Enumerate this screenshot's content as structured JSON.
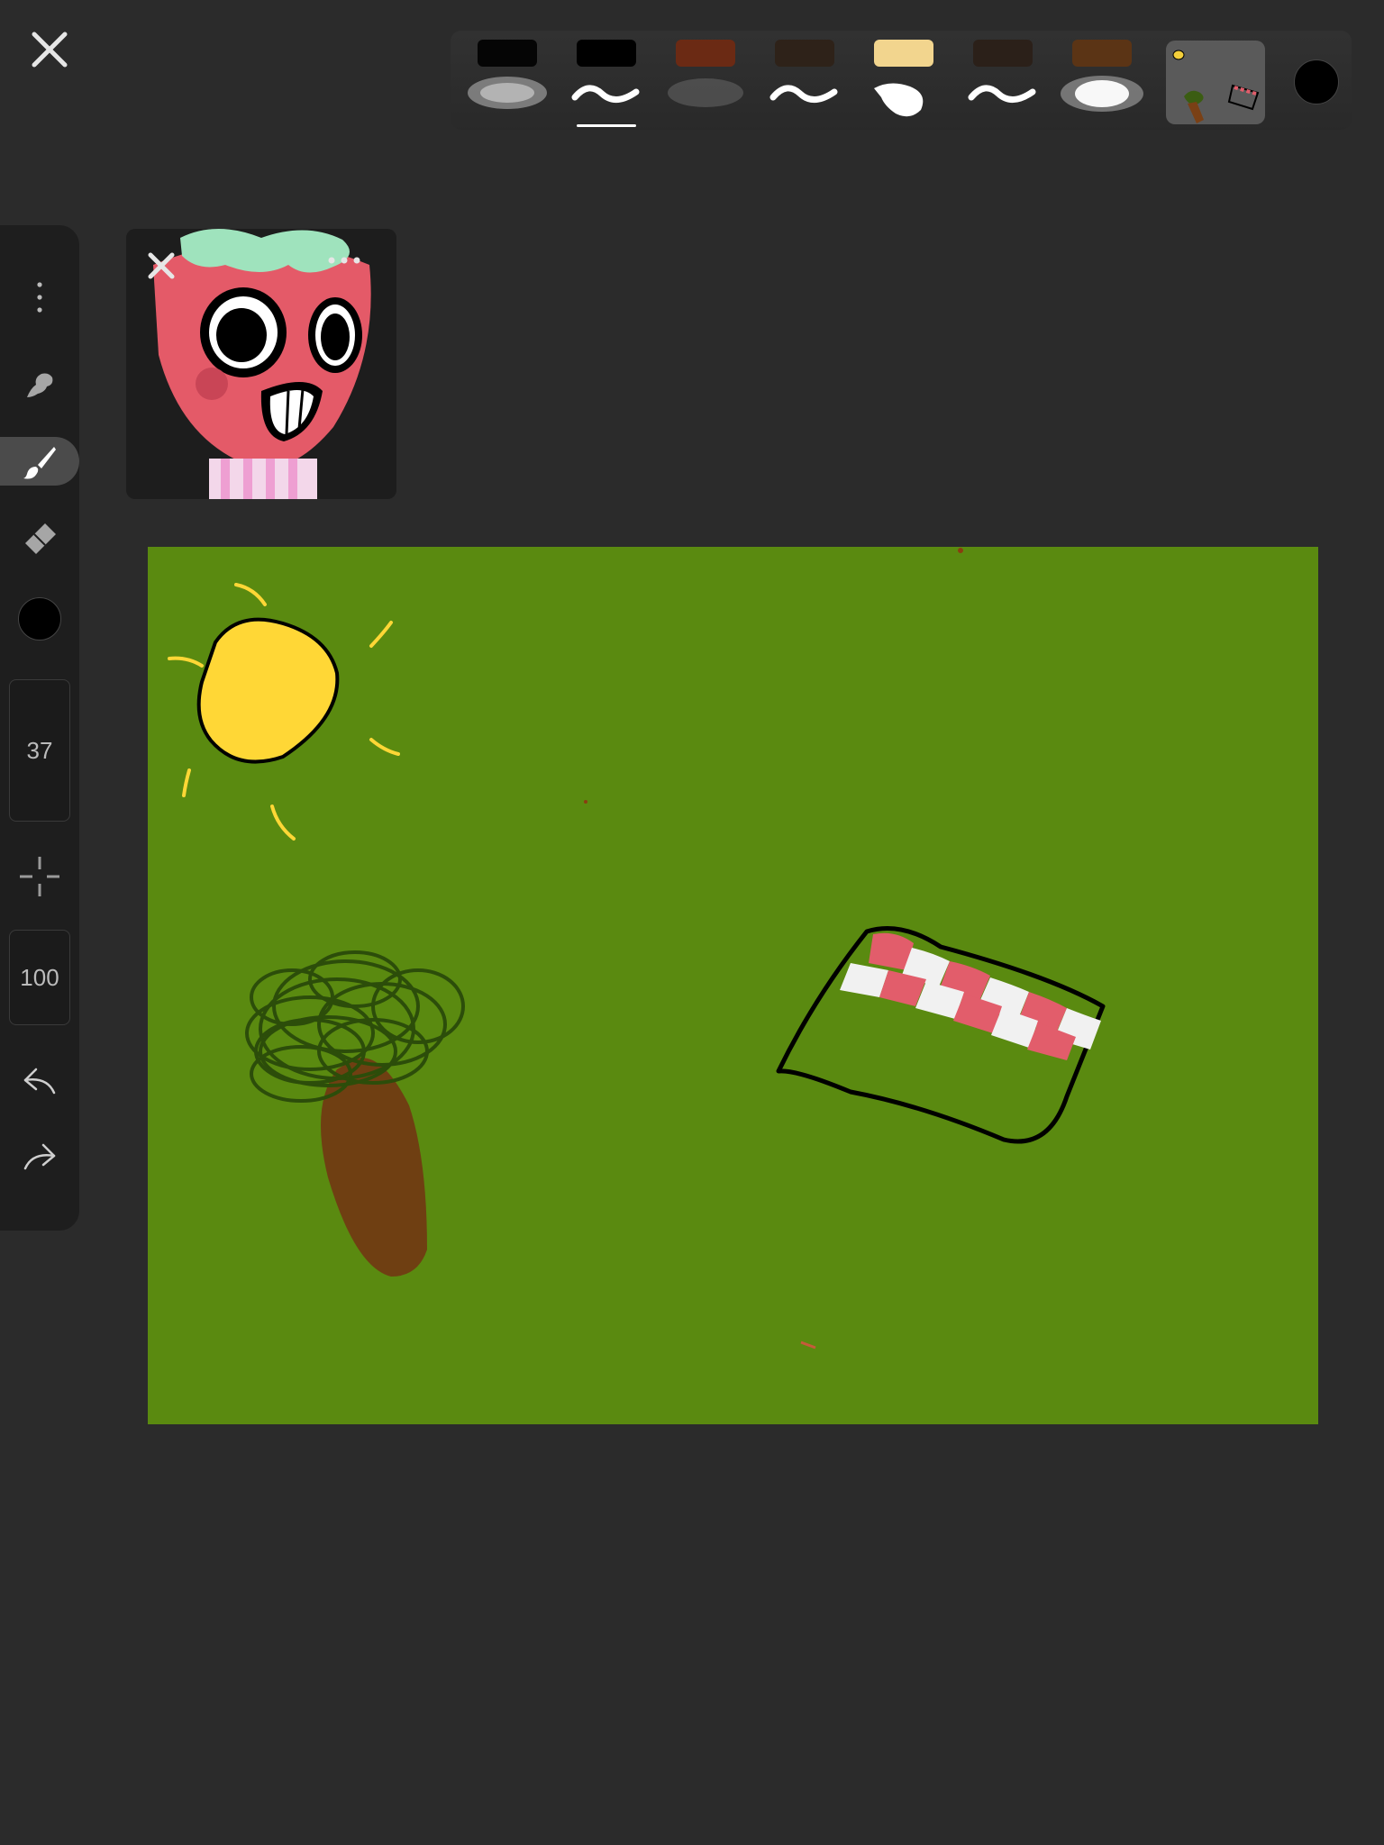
{
  "app": {
    "accent": "#ffffff",
    "background": "#2b2b2b"
  },
  "top_bar": {
    "close_icon": "close-icon",
    "brushes": [
      {
        "name": "airbrush",
        "color": "#050505",
        "selected": false
      },
      {
        "name": "pen",
        "color": "#000000",
        "selected": true
      },
      {
        "name": "airbrush",
        "color": "#6b2a14",
        "selected": false
      },
      {
        "name": "pen",
        "color": "#2e2219",
        "selected": false
      },
      {
        "name": "ink-blob",
        "color": "#f2d58e",
        "selected": false
      },
      {
        "name": "pen",
        "color": "#2b2019",
        "selected": false
      },
      {
        "name": "soft-blob",
        "color": "#5b3415",
        "selected": false
      }
    ],
    "current_color": "#000000"
  },
  "toolbar": {
    "more_icon": "more-vertical-icon",
    "smudge_icon": "smudge-icon",
    "brush_icon": "brush-icon",
    "eraser_icon": "eraser-icon",
    "color": "#000000",
    "brush_size": "37",
    "eyedropper_icon": "crosshair-icon",
    "opacity": "100",
    "undo_icon": "undo-icon",
    "redo_icon": "redo-icon"
  },
  "reference": {
    "close_icon": "close-icon",
    "more_icon": "more-horizontal-icon"
  },
  "canvas": {
    "background": "#5a8a10"
  }
}
